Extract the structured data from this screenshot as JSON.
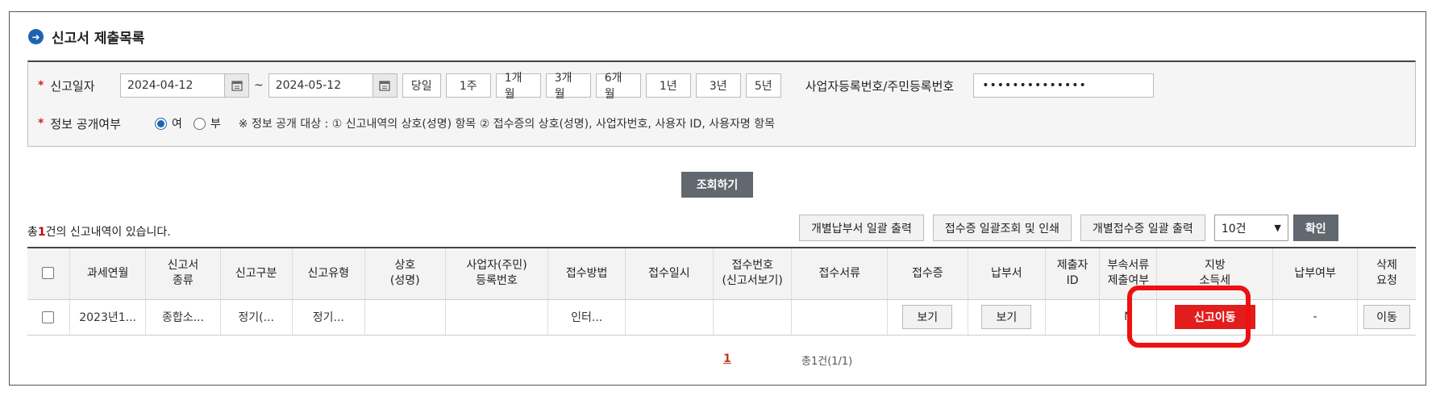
{
  "title": "신고서 제출목록",
  "search": {
    "date_label": "신고일자",
    "date_from": "2024-04-12",
    "date_to": "2024-05-12",
    "tilde": "~",
    "periods": [
      "당일",
      "1주",
      "1개월",
      "3개월",
      "6개월",
      "1년",
      "3년",
      "5년"
    ],
    "biz_label": "사업자등록번호/주민등록번호",
    "biz_value": "••••••••••••••",
    "disclosure_label": "정보 공개여부",
    "disclosure_yes": "여",
    "disclosure_no": "부",
    "disclosure_selected": "여",
    "notice": "※ 정보 공개 대상 : ① 신고내역의 상호(성명) 항목 ② 접수증의 상호(성명), 사업자번호, 사용자 ID, 사용자명 항목"
  },
  "query_button": "조회하기",
  "result": {
    "prefix": "총",
    "count": "1",
    "suffix": "건의 신고내역이 있습니다."
  },
  "actions": {
    "bulk_payment_print": "개별납부서 일괄 출력",
    "bulk_receipt_print": "접수증 일괄조회 및 인쇄",
    "bulk_individual_receipt": "개별접수증 일괄 출력",
    "page_size": "10건",
    "confirm": "확인"
  },
  "table": {
    "headers": [
      "",
      "과세연월",
      "신고서\n종류",
      "신고구분",
      "신고유형",
      "상호\n(성명)",
      "사업자(주민)\n등록번호",
      "접수방법",
      "접수일시",
      "접수번호\n(신고서보기)",
      "접수서류",
      "접수증",
      "납부서",
      "제출자\nID",
      "부속서류\n제출여부",
      "지방\n소득세",
      "납부여부",
      "삭제\n요청"
    ],
    "row": {
      "tax_period": "2023년1...",
      "form_type": "종합소...",
      "report_class": "정기(...",
      "report_type": "정기...",
      "name": "",
      "reg_no": "",
      "method": "인터...",
      "datetime": "",
      "receipt_no": "",
      "documents": "",
      "receipt_btn": "보기",
      "payment_btn": "보기",
      "submitter_id": "",
      "attachment": "N",
      "local_tax_btn": "신고이동",
      "paid": "-",
      "delete_btn": "이동"
    }
  },
  "pagination": {
    "current": "1",
    "total": "총1건(1/1)"
  },
  "colors": {
    "accent": "#1e63b0",
    "highlight": "#ee1111",
    "dark_button": "#616870"
  }
}
